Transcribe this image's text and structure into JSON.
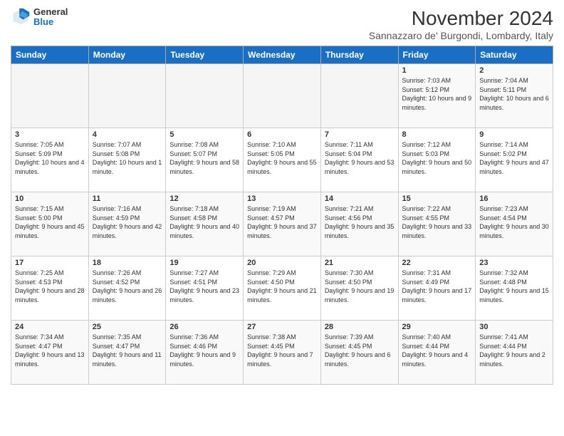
{
  "logo": {
    "general": "General",
    "blue": "Blue"
  },
  "header": {
    "title": "November 2024",
    "subtitle": "Sannazzaro de' Burgondi, Lombardy, Italy"
  },
  "weekdays": [
    "Sunday",
    "Monday",
    "Tuesday",
    "Wednesday",
    "Thursday",
    "Friday",
    "Saturday"
  ],
  "weeks": [
    [
      {
        "day": "",
        "info": ""
      },
      {
        "day": "",
        "info": ""
      },
      {
        "day": "",
        "info": ""
      },
      {
        "day": "",
        "info": ""
      },
      {
        "day": "",
        "info": ""
      },
      {
        "day": "1",
        "info": "Sunrise: 7:03 AM\nSunset: 5:12 PM\nDaylight: 10 hours and 9 minutes."
      },
      {
        "day": "2",
        "info": "Sunrise: 7:04 AM\nSunset: 5:11 PM\nDaylight: 10 hours and 6 minutes."
      }
    ],
    [
      {
        "day": "3",
        "info": "Sunrise: 7:05 AM\nSunset: 5:09 PM\nDaylight: 10 hours and 4 minutes."
      },
      {
        "day": "4",
        "info": "Sunrise: 7:07 AM\nSunset: 5:08 PM\nDaylight: 10 hours and 1 minute."
      },
      {
        "day": "5",
        "info": "Sunrise: 7:08 AM\nSunset: 5:07 PM\nDaylight: 9 hours and 58 minutes."
      },
      {
        "day": "6",
        "info": "Sunrise: 7:10 AM\nSunset: 5:05 PM\nDaylight: 9 hours and 55 minutes."
      },
      {
        "day": "7",
        "info": "Sunrise: 7:11 AM\nSunset: 5:04 PM\nDaylight: 9 hours and 53 minutes."
      },
      {
        "day": "8",
        "info": "Sunrise: 7:12 AM\nSunset: 5:03 PM\nDaylight: 9 hours and 50 minutes."
      },
      {
        "day": "9",
        "info": "Sunrise: 7:14 AM\nSunset: 5:02 PM\nDaylight: 9 hours and 47 minutes."
      }
    ],
    [
      {
        "day": "10",
        "info": "Sunrise: 7:15 AM\nSunset: 5:00 PM\nDaylight: 9 hours and 45 minutes."
      },
      {
        "day": "11",
        "info": "Sunrise: 7:16 AM\nSunset: 4:59 PM\nDaylight: 9 hours and 42 minutes."
      },
      {
        "day": "12",
        "info": "Sunrise: 7:18 AM\nSunset: 4:58 PM\nDaylight: 9 hours and 40 minutes."
      },
      {
        "day": "13",
        "info": "Sunrise: 7:19 AM\nSunset: 4:57 PM\nDaylight: 9 hours and 37 minutes."
      },
      {
        "day": "14",
        "info": "Sunrise: 7:21 AM\nSunset: 4:56 PM\nDaylight: 9 hours and 35 minutes."
      },
      {
        "day": "15",
        "info": "Sunrise: 7:22 AM\nSunset: 4:55 PM\nDaylight: 9 hours and 33 minutes."
      },
      {
        "day": "16",
        "info": "Sunrise: 7:23 AM\nSunset: 4:54 PM\nDaylight: 9 hours and 30 minutes."
      }
    ],
    [
      {
        "day": "17",
        "info": "Sunrise: 7:25 AM\nSunset: 4:53 PM\nDaylight: 9 hours and 28 minutes."
      },
      {
        "day": "18",
        "info": "Sunrise: 7:26 AM\nSunset: 4:52 PM\nDaylight: 9 hours and 26 minutes."
      },
      {
        "day": "19",
        "info": "Sunrise: 7:27 AM\nSunset: 4:51 PM\nDaylight: 9 hours and 23 minutes."
      },
      {
        "day": "20",
        "info": "Sunrise: 7:29 AM\nSunset: 4:50 PM\nDaylight: 9 hours and 21 minutes."
      },
      {
        "day": "21",
        "info": "Sunrise: 7:30 AM\nSunset: 4:50 PM\nDaylight: 9 hours and 19 minutes."
      },
      {
        "day": "22",
        "info": "Sunrise: 7:31 AM\nSunset: 4:49 PM\nDaylight: 9 hours and 17 minutes."
      },
      {
        "day": "23",
        "info": "Sunrise: 7:32 AM\nSunset: 4:48 PM\nDaylight: 9 hours and 15 minutes."
      }
    ],
    [
      {
        "day": "24",
        "info": "Sunrise: 7:34 AM\nSunset: 4:47 PM\nDaylight: 9 hours and 13 minutes."
      },
      {
        "day": "25",
        "info": "Sunrise: 7:35 AM\nSunset: 4:47 PM\nDaylight: 9 hours and 11 minutes."
      },
      {
        "day": "26",
        "info": "Sunrise: 7:36 AM\nSunset: 4:46 PM\nDaylight: 9 hours and 9 minutes."
      },
      {
        "day": "27",
        "info": "Sunrise: 7:38 AM\nSunset: 4:45 PM\nDaylight: 9 hours and 7 minutes."
      },
      {
        "day": "28",
        "info": "Sunrise: 7:39 AM\nSunset: 4:45 PM\nDaylight: 9 hours and 6 minutes."
      },
      {
        "day": "29",
        "info": "Sunrise: 7:40 AM\nSunset: 4:44 PM\nDaylight: 9 hours and 4 minutes."
      },
      {
        "day": "30",
        "info": "Sunrise: 7:41 AM\nSunset: 4:44 PM\nDaylight: 9 hours and 2 minutes."
      }
    ]
  ]
}
